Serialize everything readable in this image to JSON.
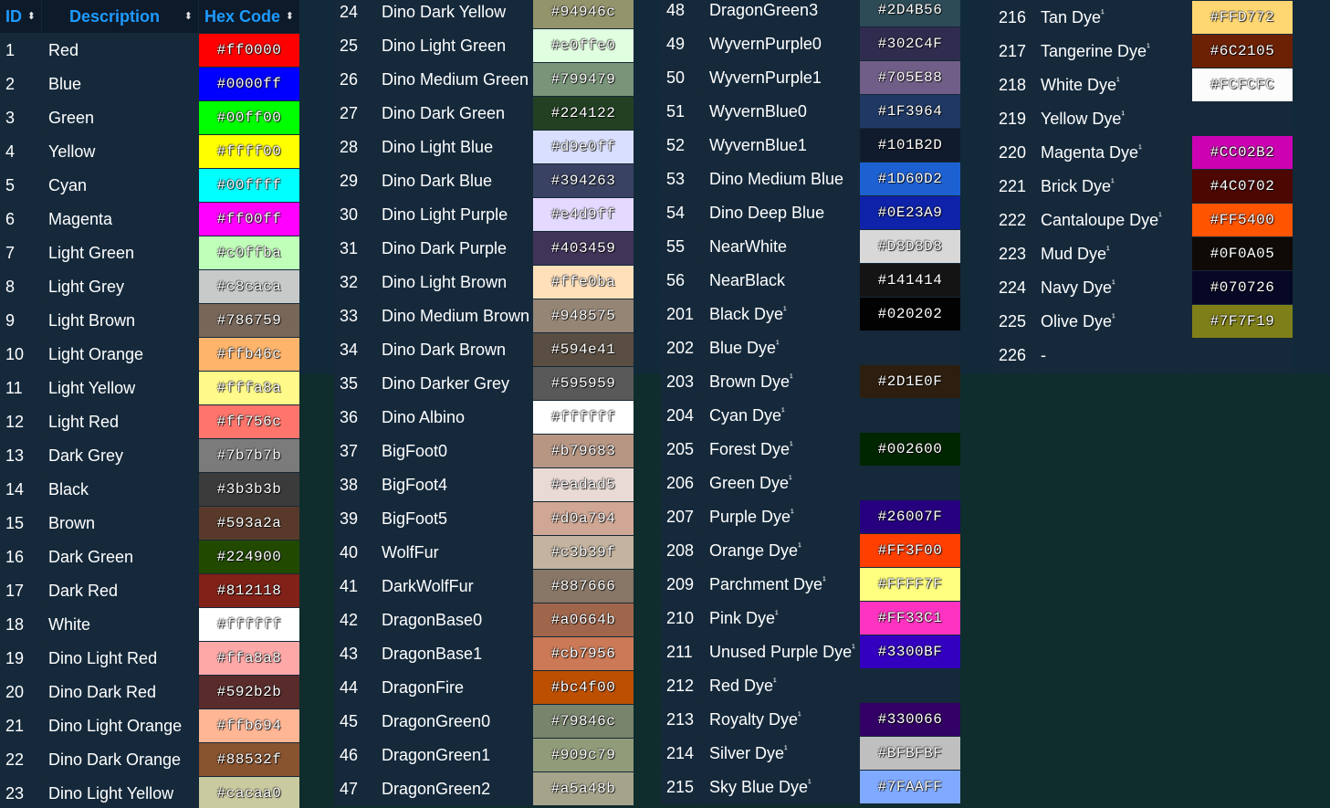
{
  "header": {
    "id": "ID",
    "description": "Description",
    "hex": "Hex Code",
    "sort_glyph": "⬍"
  },
  "columns": [
    {
      "rows": [
        {
          "id": "1",
          "name": "Red",
          "hex": "#ff0000"
        },
        {
          "id": "2",
          "name": "Blue",
          "hex": "#0000ff"
        },
        {
          "id": "3",
          "name": "Green",
          "hex": "#00ff00"
        },
        {
          "id": "4",
          "name": "Yellow",
          "hex": "#ffff00"
        },
        {
          "id": "5",
          "name": "Cyan",
          "hex": "#00ffff"
        },
        {
          "id": "6",
          "name": "Magenta",
          "hex": "#ff00ff"
        },
        {
          "id": "7",
          "name": "Light Green",
          "hex": "#c0ffba"
        },
        {
          "id": "8",
          "name": "Light Grey",
          "hex": "#c8caca"
        },
        {
          "id": "9",
          "name": "Light Brown",
          "hex": "#786759"
        },
        {
          "id": "10",
          "name": "Light Orange",
          "hex": "#ffb46c"
        },
        {
          "id": "11",
          "name": "Light Yellow",
          "hex": "#fffa8a"
        },
        {
          "id": "12",
          "name": "Light Red",
          "hex": "#ff756c"
        },
        {
          "id": "13",
          "name": "Dark Grey",
          "hex": "#7b7b7b"
        },
        {
          "id": "14",
          "name": "Black",
          "hex": "#3b3b3b"
        },
        {
          "id": "15",
          "name": "Brown",
          "hex": "#593a2a"
        },
        {
          "id": "16",
          "name": "Dark Green",
          "hex": "#224900"
        },
        {
          "id": "17",
          "name": "Dark Red",
          "hex": "#812118"
        },
        {
          "id": "18",
          "name": "White",
          "hex": "#ffffff"
        },
        {
          "id": "19",
          "name": "Dino Light Red",
          "hex": "#ffa8a8"
        },
        {
          "id": "20",
          "name": "Dino Dark Red",
          "hex": "#592b2b"
        },
        {
          "id": "21",
          "name": "Dino Light Orange",
          "hex": "#ffb694"
        },
        {
          "id": "22",
          "name": "Dino Dark Orange",
          "hex": "#88532f"
        },
        {
          "id": "23",
          "name": "Dino Light Yellow",
          "hex": "#cacaa0"
        }
      ]
    },
    {
      "rows": [
        {
          "id": "24",
          "name": "Dino Dark Yellow",
          "hex": "#94946c"
        },
        {
          "id": "25",
          "name": "Dino Light Green",
          "hex": "#e0ffe0"
        },
        {
          "id": "26",
          "name": "Dino Medium Green",
          "hex": "#799479"
        },
        {
          "id": "27",
          "name": "Dino Dark Green",
          "hex": "#224122"
        },
        {
          "id": "28",
          "name": "Dino Light Blue",
          "hex": "#d9e0ff"
        },
        {
          "id": "29",
          "name": "Dino Dark Blue",
          "hex": "#394263"
        },
        {
          "id": "30",
          "name": "Dino Light Purple",
          "hex": "#e4d9ff"
        },
        {
          "id": "31",
          "name": "Dino Dark Purple",
          "hex": "#403459"
        },
        {
          "id": "32",
          "name": "Dino Light Brown",
          "hex": "#ffe0ba"
        },
        {
          "id": "33",
          "name": "Dino Medium Brown",
          "hex": "#948575"
        },
        {
          "id": "34",
          "name": "Dino Dark Brown",
          "hex": "#594e41"
        },
        {
          "id": "35",
          "name": "Dino Darker Grey",
          "hex": "#595959"
        },
        {
          "id": "36",
          "name": "Dino Albino",
          "hex": "#ffffff"
        },
        {
          "id": "37",
          "name": "BigFoot0",
          "hex": "#b79683"
        },
        {
          "id": "38",
          "name": "BigFoot4",
          "hex": "#eadad5"
        },
        {
          "id": "39",
          "name": "BigFoot5",
          "hex": "#d0a794"
        },
        {
          "id": "40",
          "name": "WolfFur",
          "hex": "#c3b39f"
        },
        {
          "id": "41",
          "name": "DarkWolfFur",
          "hex": "#887666"
        },
        {
          "id": "42",
          "name": "DragonBase0",
          "hex": "#a0664b"
        },
        {
          "id": "43",
          "name": "DragonBase1",
          "hex": "#cb7956"
        },
        {
          "id": "44",
          "name": "DragonFire",
          "hex": "#bc4f00"
        },
        {
          "id": "45",
          "name": "DragonGreen0",
          "hex": "#79846c"
        },
        {
          "id": "46",
          "name": "DragonGreen1",
          "hex": "#909c79"
        },
        {
          "id": "47",
          "name": "DragonGreen2",
          "hex": "#a5a48b"
        }
      ]
    },
    {
      "rows": [
        {
          "id": "48",
          "name": "DragonGreen3",
          "hex": "#2D4B56"
        },
        {
          "id": "49",
          "name": "WyvernPurple0",
          "hex": "#302C4F"
        },
        {
          "id": "50",
          "name": "WyvernPurple1",
          "hex": "#705E88"
        },
        {
          "id": "51",
          "name": "WyvernBlue0",
          "hex": "#1F3964"
        },
        {
          "id": "52",
          "name": "WyvernBlue1",
          "hex": "#101B2D"
        },
        {
          "id": "53",
          "name": "Dino Medium Blue",
          "hex": "#1D60D2"
        },
        {
          "id": "54",
          "name": "Dino Deep Blue",
          "hex": "#0E23A9"
        },
        {
          "id": "55",
          "name": "NearWhite",
          "hex": "#D8D8D8"
        },
        {
          "id": "56",
          "name": "NearBlack",
          "hex": "#141414"
        },
        {
          "id": "201",
          "name": "Black Dye",
          "dye": "¹",
          "hex": "#020202"
        },
        {
          "id": "202",
          "name": "Blue Dye",
          "dye": "¹",
          "hex": ""
        },
        {
          "id": "203",
          "name": "Brown Dye",
          "dye": "¹",
          "hex": "#2D1E0F"
        },
        {
          "id": "204",
          "name": "Cyan Dye",
          "dye": "¹",
          "hex": ""
        },
        {
          "id": "205",
          "name": "Forest Dye",
          "dye": "¹",
          "hex": "#002600"
        },
        {
          "id": "206",
          "name": "Green Dye",
          "dye": "¹",
          "hex": ""
        },
        {
          "id": "207",
          "name": "Purple Dye",
          "dye": "¹",
          "hex": "#26007F"
        },
        {
          "id": "208",
          "name": "Orange Dye",
          "dye": "¹",
          "hex": "#FF3F00"
        },
        {
          "id": "209",
          "name": "Parchment Dye",
          "dye": "¹",
          "hex": "#FFFF7F"
        },
        {
          "id": "210",
          "name": "Pink Dye",
          "dye": "¹",
          "hex": "#FF33C1"
        },
        {
          "id": "211",
          "name": "Unused Purple Dye",
          "dye": "¹",
          "hex": "#3300BF"
        },
        {
          "id": "212",
          "name": "Red Dye",
          "dye": "¹",
          "hex": ""
        },
        {
          "id": "213",
          "name": "Royalty Dye",
          "dye": "¹",
          "hex": "#330066"
        },
        {
          "id": "214",
          "name": "Silver Dye",
          "dye": "¹",
          "hex": "#BFBFBF"
        },
        {
          "id": "215",
          "name": "Sky Blue Dye",
          "dye": "¹",
          "hex": "#7FAAFF"
        }
      ]
    },
    {
      "rows": [
        {
          "id": "216",
          "name": "Tan Dye",
          "dye": "¹",
          "hex": "#FFD772"
        },
        {
          "id": "217",
          "name": "Tangerine Dye",
          "dye": "¹",
          "hex": "#6C2105"
        },
        {
          "id": "218",
          "name": "White Dye",
          "dye": "¹",
          "hex": "#FCFCFC"
        },
        {
          "id": "219",
          "name": "Yellow Dye",
          "dye": "¹",
          "hex": ""
        },
        {
          "id": "220",
          "name": "Magenta Dye",
          "dye": "¹",
          "hex": "#CC02B2"
        },
        {
          "id": "221",
          "name": "Brick Dye",
          "dye": "¹",
          "hex": "#4C0702"
        },
        {
          "id": "222",
          "name": "Cantaloupe Dye",
          "dye": "¹",
          "hex": "#FF5400"
        },
        {
          "id": "223",
          "name": "Mud Dye",
          "dye": "¹",
          "hex": "#0F0A05"
        },
        {
          "id": "224",
          "name": "Navy Dye",
          "dye": "¹",
          "hex": "#070726"
        },
        {
          "id": "225",
          "name": "Olive Dye",
          "dye": "¹",
          "hex": "#7F7F19"
        },
        {
          "id": "226",
          "name": "-",
          "hex": ""
        }
      ]
    }
  ]
}
